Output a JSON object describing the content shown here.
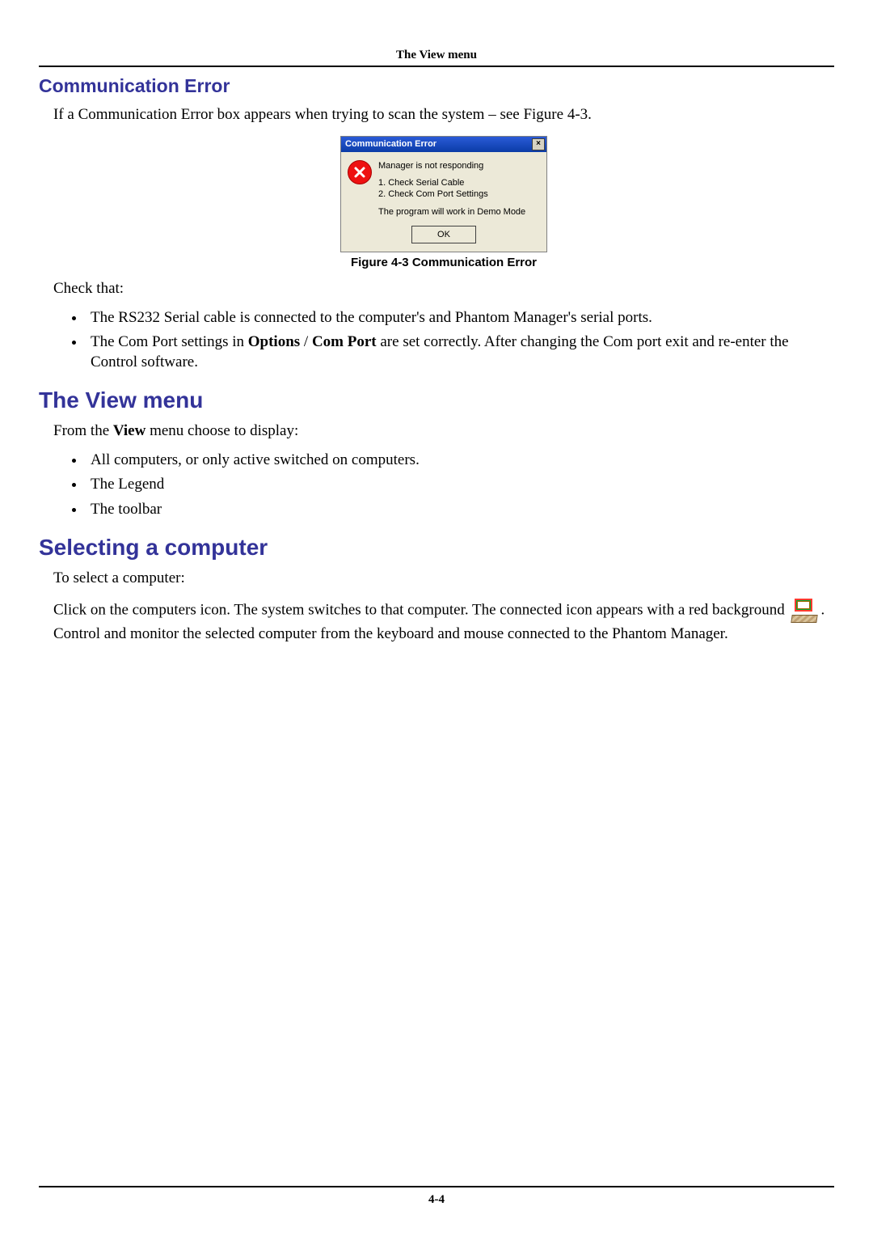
{
  "running_head": "The View menu",
  "section1": {
    "heading": "Communication Error",
    "intro": "If a Communication Error box appears when trying to scan the system – see Figure 4-3.",
    "figure_caption": "Figure 4-3 Communication Error",
    "check_that": "Check that:",
    "bullets": {
      "b1": "The RS232 Serial cable is connected to the computer's and Phantom Manager's serial ports.",
      "b2_pre": "The Com Port settings in ",
      "b2_bold1": "Options",
      "b2_mid": " / ",
      "b2_bold2": "Com Port",
      "b2_post": " are set correctly. After changing the Com port exit and re-enter the Control software."
    }
  },
  "dialog": {
    "title": "Communication Error",
    "msg1": "Manager is not responding",
    "msg2a": "1. Check Serial Cable",
    "msg2b": "2. Check Com Port Settings",
    "msg3": "The program will work in Demo Mode",
    "ok": "OK",
    "close": "×"
  },
  "section2": {
    "heading": "The View menu",
    "intro_pre": "From the ",
    "intro_bold": "View",
    "intro_post": " menu choose to display:",
    "bullets": {
      "b1": "All computers, or only active switched on computers.",
      "b2": "The Legend",
      "b3": "The toolbar"
    }
  },
  "section3": {
    "heading": "Selecting a computer",
    "p1": "To select a computer:",
    "p2_before": "Click on the computers icon. The system switches to that computer. The connected icon appears with a red background ",
    "p2_after": ". Control and monitor the selected computer from the keyboard and mouse connected to the Phantom Manager."
  },
  "page_number": "4-4"
}
